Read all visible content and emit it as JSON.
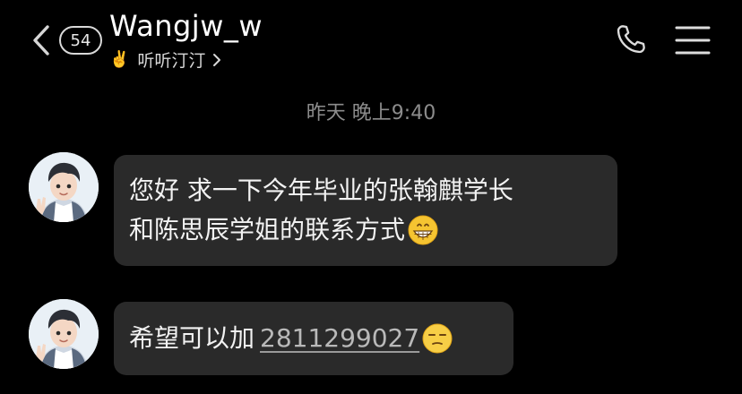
{
  "header": {
    "back_icon": "chevron-left-icon",
    "unread_count": "54",
    "contact_name": "Wangjw_w",
    "status_emoji": "✌️",
    "status_text": "听听汀汀",
    "status_chevron_icon": "chevron-right-icon",
    "call_icon": "phone-icon",
    "menu_icon": "hamburger-menu-icon"
  },
  "chat": {
    "timestamp": "昨天 晚上9:40",
    "messages": [
      {
        "line1": "您好 求一下今年毕业的张翰麒学长",
        "line2": "和陈思辰学姐的联系方式",
        "emoji_icon": "grinning-face-emoji"
      },
      {
        "text": "希望可以加",
        "phone": "2811299027",
        "emoji_icon": "unamused-face-emoji"
      }
    ]
  },
  "colors": {
    "background": "#000000",
    "bubble": "#2a2a2a",
    "timestamp": "#8c8c8c",
    "link": "#b9b9b9"
  }
}
